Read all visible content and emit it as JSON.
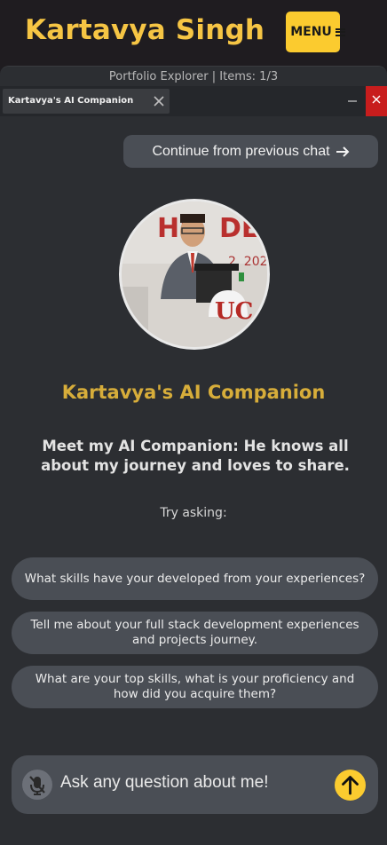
{
  "header": {
    "brand": "Kartavya Singh",
    "menu_label": "MENU",
    "menu_icon": "hamburger-icon",
    "accent": "#fbcb2f"
  },
  "window": {
    "status": "Portfolio Explorer | Items: 1/3",
    "tab_label": "Kartavya's AI Companion",
    "tab_close_icon": "close-icon",
    "minimize_icon": "minimize-icon",
    "close_icon": "close-icon",
    "close_color": "#c81d1d"
  },
  "chat": {
    "continue_label": "Continue from previous chat",
    "continue_icon": "arrow-right-icon",
    "avatar": "profile-photo",
    "title": "Kartavya's AI Companion",
    "intro": "Meet my AI Companion: He knows all about my journey and loves to share.",
    "try_label": "Try asking:",
    "suggestions": [
      "What skills have your developed from your experiences?",
      "Tell me about your full stack development experiences and projects journey.",
      "What are your top skills, what is your proficiency and how did you acquire them?"
    ],
    "input_placeholder": "Ask any question about me!",
    "mic_icon": "mic-off-icon",
    "send_icon": "arrow-up-icon"
  }
}
